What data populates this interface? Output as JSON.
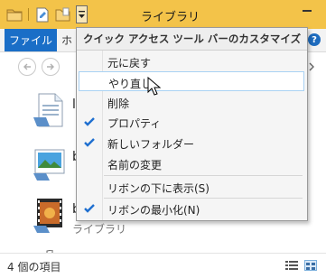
{
  "window": {
    "title": "ライブラリ",
    "quick_access": {
      "icons": [
        "folder-icon",
        "properties-icon",
        "new-folder-icon",
        "dropdown-arrow-icon"
      ]
    }
  },
  "ribbon": {
    "file_tab": "ファイル",
    "home_tab_partial": "ホ",
    "help": "?"
  },
  "menu": {
    "header": "クイック アクセス ツール バーのカスタマイズ",
    "items": [
      {
        "label": "元に戻す",
        "checked": false
      },
      {
        "label": "やり直し",
        "checked": false,
        "hovered": true
      },
      {
        "label": "削除",
        "checked": false
      },
      {
        "label": "プロパティ",
        "checked": true
      },
      {
        "label": "新しいフォルダー",
        "checked": true
      },
      {
        "label": "名前の変更",
        "checked": false
      },
      {
        "label": "リボンの下に表示(S)",
        "checked": false
      },
      {
        "label": "リボンの最小化(N)",
        "checked": true
      }
    ]
  },
  "content": {
    "items": [
      {
        "name": "l",
        "sub": "",
        "icon": "documents-library-icon"
      },
      {
        "name": "b",
        "sub": "",
        "icon": "pictures-library-icon"
      },
      {
        "name": "b",
        "sub": "ライブラリ",
        "icon": "videos-library-icon"
      }
    ]
  },
  "status": {
    "item_count": "4 個の項目"
  },
  "colors": {
    "titlebar": "#f3c349",
    "file_tab": "#1a6ec7",
    "check": "#1f6fd0",
    "menu_hover_border": "#a9d2f3"
  }
}
